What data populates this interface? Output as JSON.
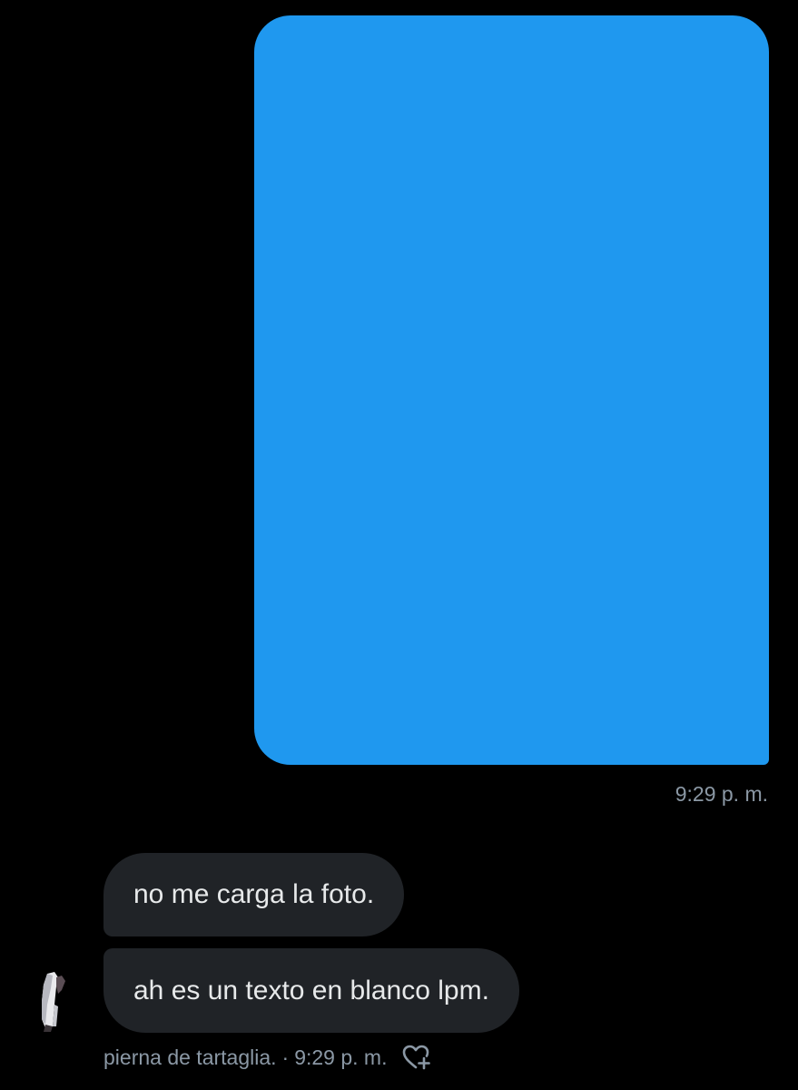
{
  "colors": {
    "background": "#000000",
    "sent_image_placeholder": "#1f98ef",
    "received_bubble": "#202327",
    "message_text": "#e7e9ea",
    "meta_text": "#8b98a5"
  },
  "sent_message": {
    "type": "image",
    "time": "9:29 p. m."
  },
  "received_messages": [
    {
      "text": "no me carga la foto."
    },
    {
      "text": "ah es un texto en blanco lpm."
    }
  ],
  "received_meta": {
    "sender_name": "pierna de tartaglia.",
    "separator": "·",
    "time": "9:29 p. m.",
    "reaction_icon": "heart-plus-icon"
  }
}
